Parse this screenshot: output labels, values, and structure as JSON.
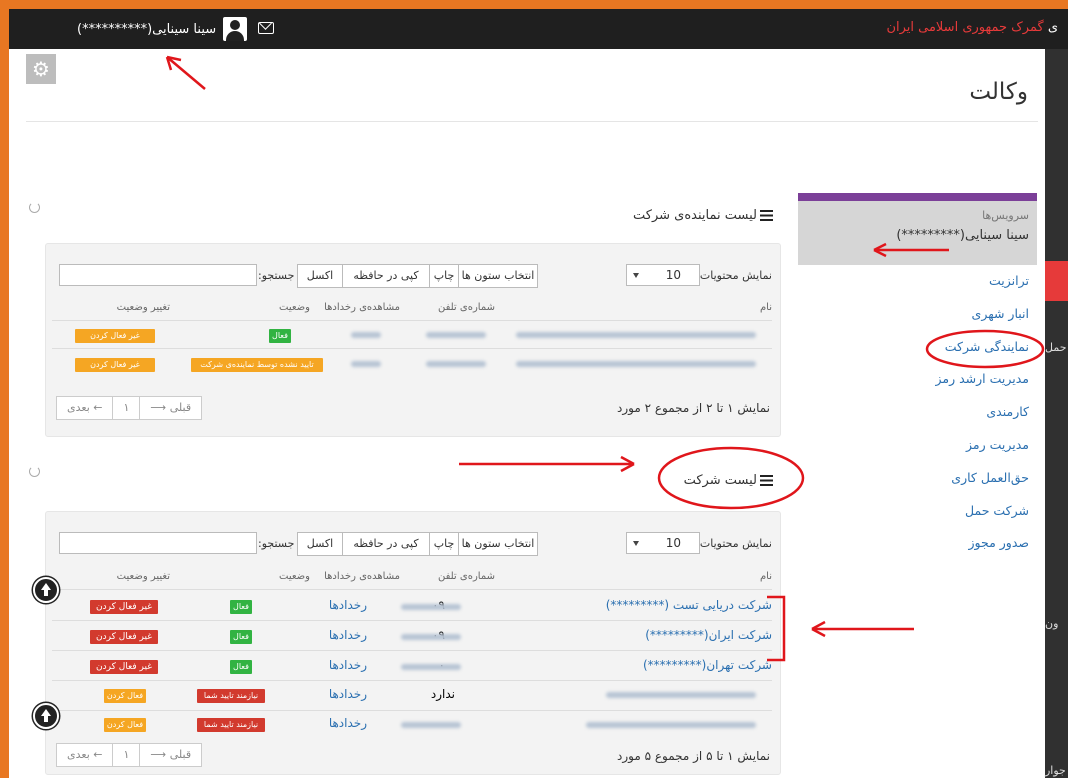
{
  "topbar": {
    "org_title": "گمرک جمهوری اسلامی ایران",
    "username": "سینا سینایی(**********)"
  },
  "page": {
    "title": "وکالت"
  },
  "sidebar": {
    "services_label": "سرویس‌ها",
    "user_name": "سینا سینایی(*********)",
    "items": [
      {
        "label": "ترانزیت"
      },
      {
        "label": "انبار شهری"
      },
      {
        "label": "نمایندگی شرکت"
      },
      {
        "label": "مدیریت ارشد رمز"
      },
      {
        "label": "کارمندی"
      },
      {
        "label": "مدیریت رمز"
      },
      {
        "label": "حق‌العمل کاری"
      },
      {
        "label": "شرکت حمل"
      },
      {
        "label": "صدور مجوز"
      }
    ]
  },
  "rail": {
    "text1": "حمل",
    "text2": "ون",
    "text3": "جوار"
  },
  "table_controls": {
    "show_entries_label": "نمایش محتویات",
    "page_length": "10",
    "choose_columns": "انتخاب ستون ها",
    "print": "چاپ",
    "copy": "کپی در حافظه",
    "excel": "اکسل",
    "search_label": "جستجو:"
  },
  "representatives_section": {
    "title": "لیست نماینده‌ی شرکت",
    "headers": {
      "name": "نام",
      "phone": "شماره‌ی تلفن",
      "events": "مشاهده‌ی رخدادها",
      "status": "وضعیت",
      "change": "تغییر وضعیت"
    },
    "rows": [
      {
        "status": "فعال",
        "action": "غیر فعال کردن"
      },
      {
        "status": "تایید نشده توسط نماینده‌ی شرکت",
        "action": "غیر فعال کردن"
      }
    ],
    "info": "نمایش ۱ تا ۲ از مجموع ۲ مورد",
    "pager": {
      "prev": "قبلی",
      "page": "۱",
      "next": "بعدی"
    }
  },
  "companies_section": {
    "title": "لیست شرکت",
    "headers": {
      "name": "نام",
      "phone": "شماره‌ی تلفن",
      "events": "مشاهده‌ی رخدادها",
      "status": "وضعیت",
      "change": "تغییر وضعیت"
    },
    "rows": [
      {
        "name": "شرکت دریایی تست (*********)",
        "phone": "۰۹",
        "events": "رخدادها",
        "status": "فعال",
        "action": "غیر فعال کردن"
      },
      {
        "name": "شرکت ایران(*********)",
        "phone": "۰۹",
        "events": "رخدادها",
        "status": "فعال",
        "action": "غیر فعال کردن"
      },
      {
        "name": "شرکت تهران(*********)",
        "phone": "۰",
        "events": "رخدادها",
        "status": "فعال",
        "action": "غیر فعال کردن"
      },
      {
        "name": "",
        "phone": "ندارد",
        "events": "رخدادها",
        "status": "نیازمند تایید شما",
        "action": "فعال کردن"
      },
      {
        "name": "",
        "phone": "",
        "events": "رخدادها",
        "status": "نیازمند تایید شما",
        "action": "فعال کردن"
      }
    ],
    "info": "نمایش ۱ تا ۵ از مجموع ۵ مورد",
    "pager": {
      "prev": "قبلی",
      "page": "۱",
      "next": "بعدی"
    }
  },
  "colors": {
    "accent_red": "#e63a3a",
    "link_blue": "#2a6fb0",
    "frame_orange": "#e87722",
    "sidebar_purple": "#7b3f98"
  }
}
